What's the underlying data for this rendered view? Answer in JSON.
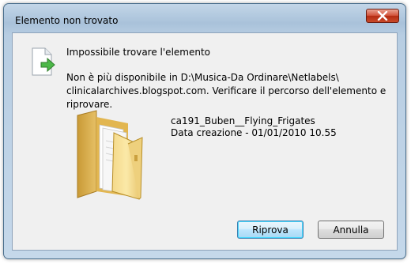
{
  "window": {
    "title": "Elemento non trovato"
  },
  "dialog": {
    "heading": "Impossibile trovare l'elemento",
    "message_line1": "Non è più disponibile in D:\\Musica-Da Ordinare\\Netlabels\\",
    "message_line2": "clinicalarchives.blogspot.com. Verificare il percorso dell'elemento e riprovare.",
    "item_name": "ca191_Buben__Flying_Frigates",
    "item_date": "Data creazione - 01/01/2010 10.55"
  },
  "buttons": {
    "retry": "Riprova",
    "cancel": "Annulla"
  },
  "icons": {
    "close": "close-icon",
    "document": "document-arrow-icon",
    "folder": "folder-icon"
  },
  "colors": {
    "close_button": "#c84a2a",
    "default_button_border": "#3c7fb1",
    "client_bg": "#f0f0f0"
  }
}
